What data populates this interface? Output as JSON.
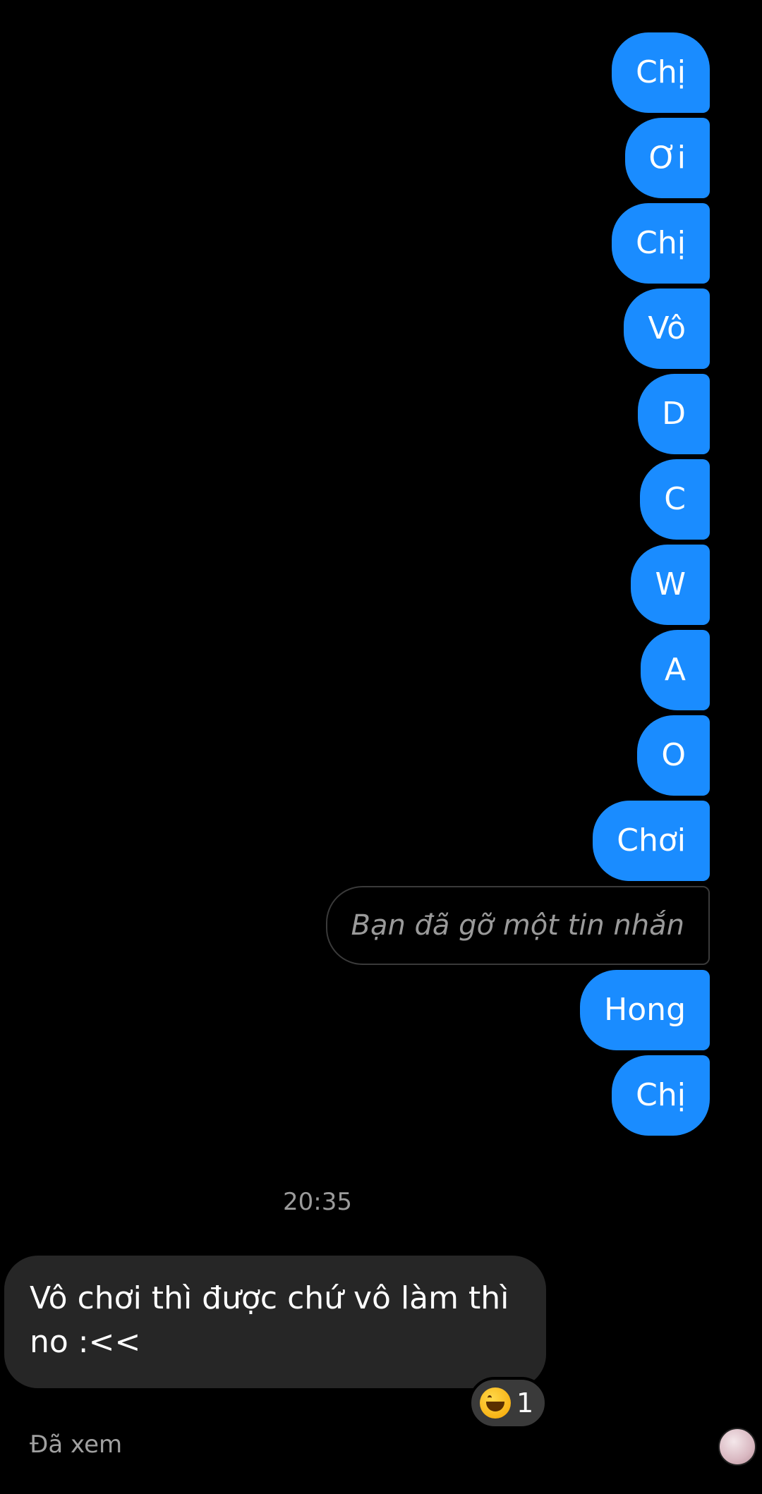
{
  "sent_messages": [
    {
      "text": "Chị"
    },
    {
      "text": "Ơi"
    },
    {
      "text": "Chị"
    },
    {
      "text": "Vô"
    },
    {
      "text": "D"
    },
    {
      "text": "C"
    },
    {
      "text": "W"
    },
    {
      "text": "A"
    },
    {
      "text": "O"
    },
    {
      "text": "Chơi"
    },
    {
      "text": "Bạn đã gỡ một tin nhắn"
    },
    {
      "text": "Hong"
    },
    {
      "text": "Chị"
    }
  ],
  "timestamp": "20:35",
  "received_message": {
    "text": "Vô chơi thì được chứ vô làm thì no :<<"
  },
  "reaction": {
    "emoji_icon": "grinning-squinting-face-icon",
    "count": "1"
  },
  "seen_status": "Đã xem",
  "colors": {
    "sent_bubble": "#1a8cff",
    "received_bubble": "#262626",
    "background": "#000000"
  }
}
